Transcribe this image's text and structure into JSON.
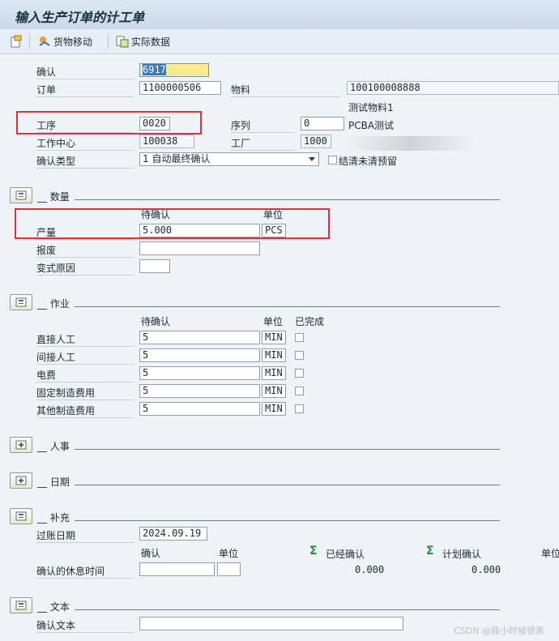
{
  "window": {
    "title": "输入生产订单的计工单"
  },
  "toolbar": {
    "goods_movement": "货物移动",
    "actual_data": "实际数据"
  },
  "header": {
    "confirmation_label": "确认",
    "confirmation_value": "6917",
    "order_label": "订单",
    "order_value": "1100000506",
    "material_label": "物料",
    "material_value": "100100008888",
    "material_desc": "测试物料1",
    "operation_label": "工序",
    "operation_value": "0020",
    "sequence_label": "序列",
    "sequence_value": "0",
    "sequence_desc": "PCBA测试",
    "work_center_label": "工作中心",
    "work_center_value": "100038",
    "plant_label": "工厂",
    "plant_value": "1000",
    "conf_type_label": "确认类型",
    "conf_type_value": "1 自动最终确认",
    "clear_reservations_label": "结清未清预留"
  },
  "quantity": {
    "section_title": "数量",
    "col_to_confirm": "待确认",
    "col_unit": "单位",
    "yield_label": "产量",
    "yield_value": "5.000",
    "yield_unit": "PCS",
    "scrap_label": "报废",
    "scrap_value": "",
    "variance_label": "变式原因",
    "variance_value": ""
  },
  "activities": {
    "section_title": "作业",
    "col_to_confirm": "待确认",
    "col_unit": "单位",
    "col_done": "已完成",
    "rows": [
      {
        "label": "直接人工",
        "value": "5",
        "unit": "MIN"
      },
      {
        "label": "间接人工",
        "value": "5",
        "unit": "MIN"
      },
      {
        "label": "电费",
        "value": "5",
        "unit": "MIN"
      },
      {
        "label": "固定制造费用",
        "value": "5",
        "unit": "MIN"
      },
      {
        "label": "其他制造费用",
        "value": "5",
        "unit": "MIN"
      }
    ]
  },
  "personnel": {
    "section_title": "人事"
  },
  "dates": {
    "section_title": "日期"
  },
  "supplement": {
    "section_title": "补充",
    "posting_date_label": "过账日期",
    "posting_date_value": "2024.09.19",
    "col_confirm": "确认",
    "col_unit": "单位",
    "col_confirmed": "已经确认",
    "col_planned": "计划确认",
    "col_unit2": "单位",
    "break_time_label": "确认的休息时间",
    "break_time_value": "",
    "break_time_unit": "",
    "confirmed_value": "0.000",
    "planned_value": "0.000"
  },
  "text": {
    "section_title": "文本",
    "conf_text_label": "确认文本",
    "conf_text_value": ""
  },
  "watermark": "CSDN @我小时候很黑",
  "colors": {
    "highlight_box": "#e0303c",
    "focus_field": "#fde98e",
    "sum_icon": "#2d8a3a"
  }
}
